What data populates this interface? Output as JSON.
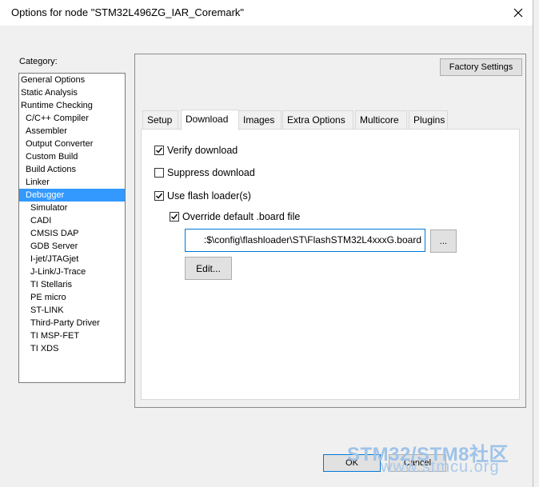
{
  "window": {
    "title": "Options for node \"STM32L496ZG_IAR_Coremark\""
  },
  "category": {
    "label": "Category:",
    "items": [
      {
        "label": "General Options",
        "level": 0
      },
      {
        "label": "Static Analysis",
        "level": 0
      },
      {
        "label": "Runtime Checking",
        "level": 0
      },
      {
        "label": "C/C++ Compiler",
        "level": 1
      },
      {
        "label": "Assembler",
        "level": 1
      },
      {
        "label": "Output Converter",
        "level": 1
      },
      {
        "label": "Custom Build",
        "level": 1
      },
      {
        "label": "Build Actions",
        "level": 1
      },
      {
        "label": "Linker",
        "level": 1
      },
      {
        "label": "Debugger",
        "level": 1,
        "selected": true
      },
      {
        "label": "Simulator",
        "level": 2
      },
      {
        "label": "CADI",
        "level": 2
      },
      {
        "label": "CMSIS DAP",
        "level": 2
      },
      {
        "label": "GDB Server",
        "level": 2
      },
      {
        "label": "I-jet/JTAGjet",
        "level": 2
      },
      {
        "label": "J-Link/J-Trace",
        "level": 2
      },
      {
        "label": "TI Stellaris",
        "level": 2
      },
      {
        "label": "PE micro",
        "level": 2
      },
      {
        "label": "ST-LINK",
        "level": 2
      },
      {
        "label": "Third-Party Driver",
        "level": 2
      },
      {
        "label": "TI MSP-FET",
        "level": 2
      },
      {
        "label": "TI XDS",
        "level": 2
      }
    ]
  },
  "factory_settings_label": "Factory Settings",
  "tabs": [
    {
      "label": "Setup"
    },
    {
      "label": "Download",
      "active": true
    },
    {
      "label": "Images"
    },
    {
      "label": "Extra Options"
    },
    {
      "label": "Multicore"
    },
    {
      "label": "Plugins"
    }
  ],
  "download": {
    "verify_download": {
      "label": "Verify download",
      "checked": true
    },
    "suppress_download": {
      "label": "Suppress download",
      "checked": false
    },
    "use_flash_loader": {
      "label": "Use flash loader(s)",
      "checked": true
    },
    "override_board_file": {
      "label": "Override default .board file",
      "checked": true
    },
    "board_file_path": ":$\\config\\flashloader\\ST\\FlashSTM32L4xxxG.board",
    "browse_label": "...",
    "edit_label": "Edit..."
  },
  "footer": {
    "ok_label": "OK",
    "cancel_label": "Cancel"
  },
  "watermark": {
    "line1": "STM32/STM8社区",
    "line2": "www.stmcu.org"
  },
  "colors": {
    "selection": "#3399ff",
    "input_focus_border": "#0078d7",
    "watermark": "#9fc3e8"
  }
}
